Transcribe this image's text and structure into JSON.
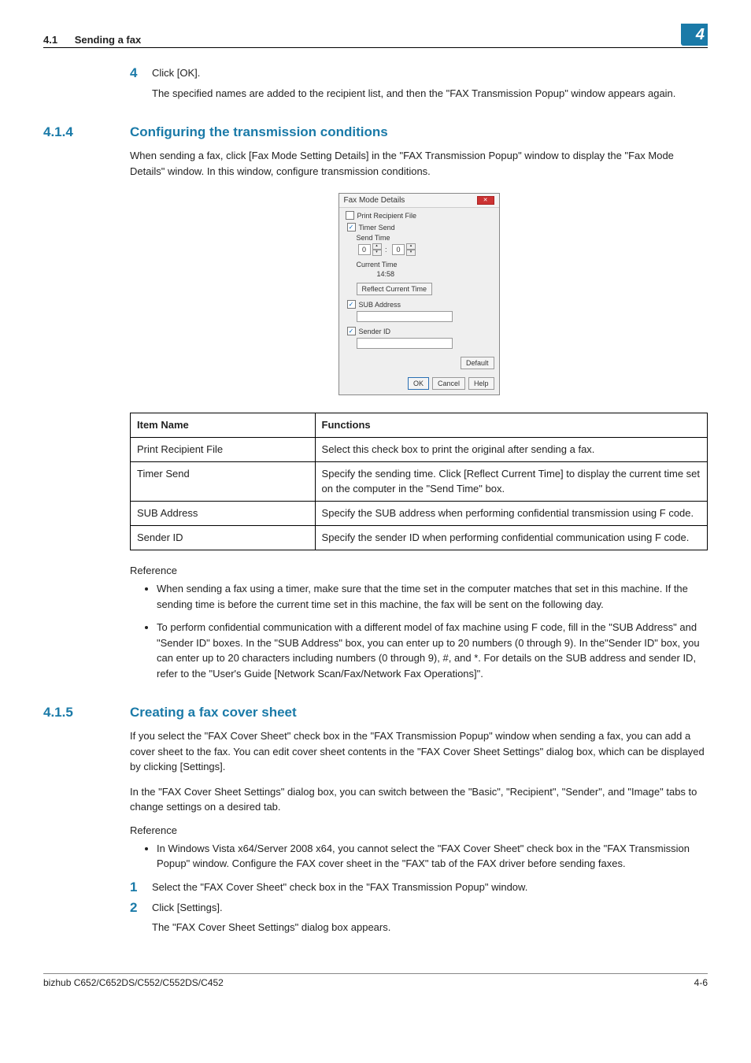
{
  "runhead": {
    "section_num": "4.1",
    "section_title": "Sending a fax",
    "chapter_badge": "4"
  },
  "step4": {
    "num": "4",
    "text": "Click [OK].",
    "sub": "The specified names are added to the recipient list, and then the \"FAX Transmission Popup\" window appears again."
  },
  "sec_414": {
    "num": "4.1.4",
    "title": "Configuring the transmission conditions",
    "intro": "When sending a fax, click [Fax Mode Setting Details] in the \"FAX Transmission Popup\" window to display the \"Fax Mode Details\" window. In this window, configure transmission conditions."
  },
  "dialog": {
    "title": "Fax Mode Details",
    "print_recipient_file": "Print Recipient File",
    "timer_send": "Timer Send",
    "send_time": "Send Time",
    "hour": "0",
    "min": "0",
    "current_time_label": "Current Time",
    "current_time_value": "14:58",
    "reflect_btn": "Reflect Current Time",
    "sub_address": "SUB Address",
    "sender_id": "Sender ID",
    "default_btn": "Default",
    "ok_btn": "OK",
    "cancel_btn": "Cancel",
    "help_btn": "Help"
  },
  "table": {
    "head_item": "Item Name",
    "head_func": "Functions",
    "rows": [
      {
        "item": "Print Recipient File",
        "func": "Select this check box to print the original after sending a fax."
      },
      {
        "item": "Timer Send",
        "func": "Specify the sending time. Click [Reflect Current Time] to display the current time set on the computer in the \"Send Time\" box."
      },
      {
        "item": "SUB Address",
        "func": "Specify the SUB address when performing confidential transmission using F code."
      },
      {
        "item": "Sender ID",
        "func": "Specify the sender ID when performing confidential communication using F code."
      }
    ]
  },
  "reference_414": {
    "label": "Reference",
    "bullets": [
      "When sending a fax using a timer, make sure that the time set in the computer matches that set in this machine. If the sending time is before the current time set in this machine, the fax will be sent on the following day.",
      "To perform confidential communication with a different model of fax machine using F code, fill in the \"SUB Address\" and \"Sender ID\" boxes. In the \"SUB Address\" box, you can enter up to 20 numbers (0 through 9). In the\"Sender ID\" box, you can enter up to 20 characters including numbers (0 through 9), #, and *. For details on the SUB address and sender ID, refer to the \"User's Guide [Network Scan/Fax/Network Fax Operations]\"."
    ]
  },
  "sec_415": {
    "num": "4.1.5",
    "title": "Creating a fax cover sheet",
    "p1": "If you select the \"FAX Cover Sheet\" check box in the \"FAX Transmission Popup\" window when sending a fax, you can add a cover sheet to the fax. You can edit cover sheet contents in the \"FAX Cover Sheet Settings\" dialog box, which can be displayed by clicking [Settings].",
    "p2": "In the \"FAX Cover Sheet Settings\" dialog box, you can switch between the \"Basic\", \"Recipient\", \"Sender\", and \"Image\" tabs to change settings on a desired tab.",
    "ref_label": "Reference",
    "ref_bullets": [
      "In Windows Vista x64/Server 2008 x64, you cannot select the \"FAX Cover Sheet\" check box in the \"FAX Transmission Popup\" window. Configure the FAX cover sheet in the \"FAX\" tab of the FAX driver before sending faxes."
    ],
    "step1": {
      "num": "1",
      "text": "Select the \"FAX Cover Sheet\" check box in the \"FAX Transmission Popup\" window."
    },
    "step2": {
      "num": "2",
      "text": "Click [Settings].",
      "sub": "The \"FAX Cover Sheet Settings\" dialog box appears."
    }
  },
  "footer": {
    "left": "bizhub C652/C652DS/C552/C552DS/C452",
    "right": "4-6"
  }
}
